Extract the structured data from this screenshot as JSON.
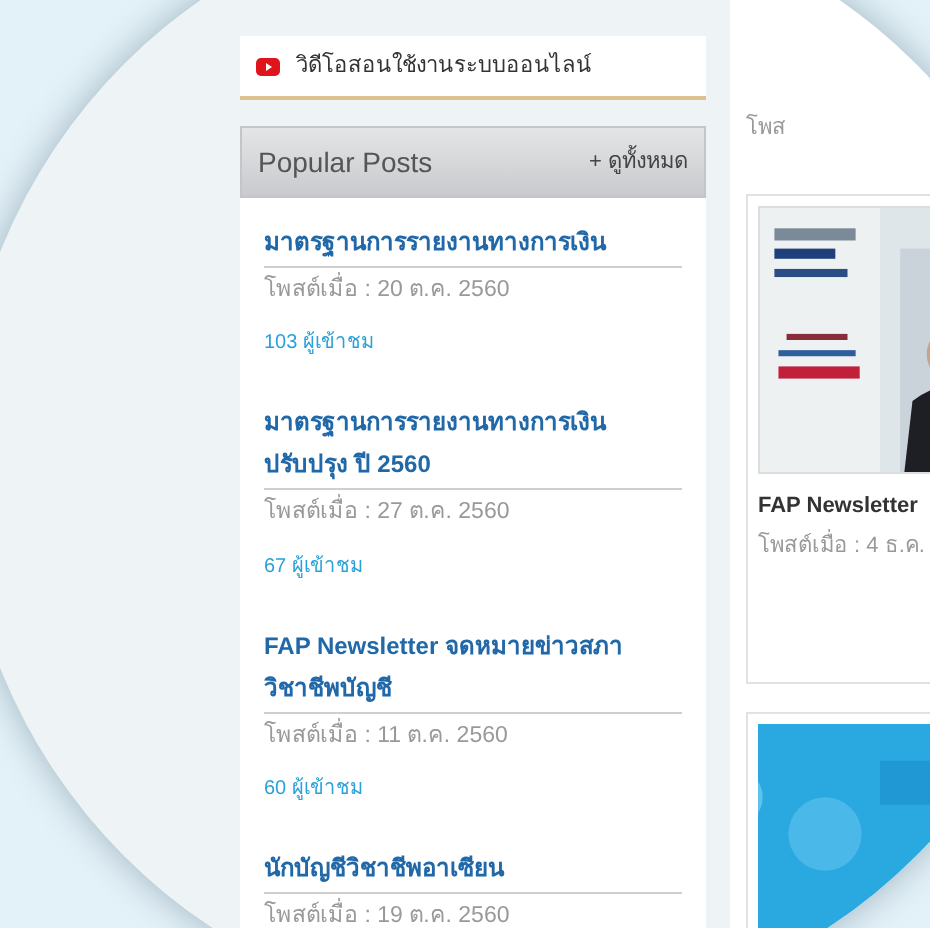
{
  "video_link": {
    "label": "วิดีโอสอนใช้งานระบบออนไลน์"
  },
  "popular_posts": {
    "title": "Popular Posts",
    "view_all": "+ ดูทั้งหมด",
    "posts": [
      {
        "title": "มาตรฐานการรายงานทางการเงิน",
        "date": "โพสต์เมื่อ : 20 ต.ค. 2560",
        "views": "103 ผู้เข้าชม"
      },
      {
        "title": "มาตรฐานการรายงานทางการเงิน ปรับปรุง ปี 2560",
        "date": "โพสต์เมื่อ : 27 ต.ค. 2560",
        "views": "67 ผู้เข้าชม"
      },
      {
        "title": "FAP Newsletter จดหมายข่าวสภาวิชาชีพบัญชี",
        "date": "โพสต์เมื่อ : 11 ต.ค. 2560",
        "views": "60 ผู้เข้าชม"
      },
      {
        "title": "นักบัญชีวิชาชีพอาเซียน",
        "date": "โพสต์เมื่อ : 19 ต.ค. 2560"
      }
    ]
  },
  "news": {
    "top_date": "โพส",
    "cards": [
      {
        "kind": "picture",
        "title": "FAP Newsletter",
        "date": "โพสต์เมื่อ : 4 ธ.ค."
      },
      {
        "kind": "picture"
      }
    ]
  }
}
